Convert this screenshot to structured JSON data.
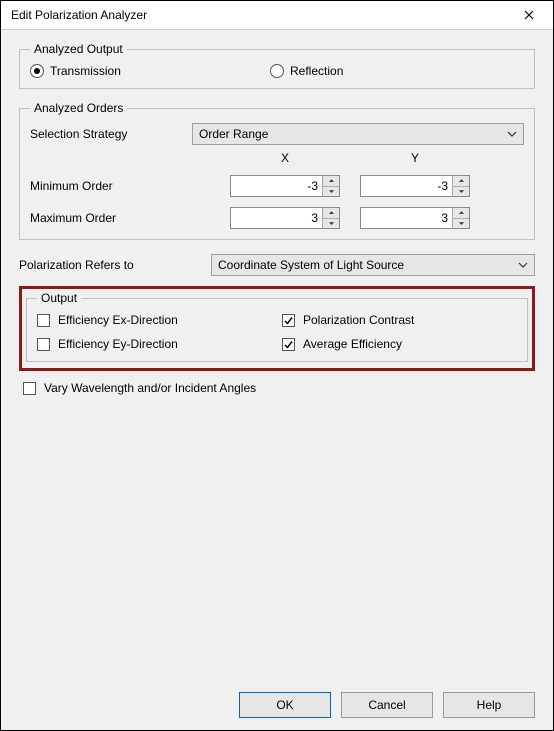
{
  "title": "Edit Polarization Analyzer",
  "analyzed_output": {
    "legend": "Analyzed Output",
    "transmission_label": "Transmission",
    "reflection_label": "Reflection",
    "selected": "transmission"
  },
  "analyzed_orders": {
    "legend": "Analyzed Orders",
    "strategy_label": "Selection Strategy",
    "strategy_value": "Order Range",
    "x_label": "X",
    "y_label": "Y",
    "min_label": "Minimum Order",
    "max_label": "Maximum Order",
    "min_x": "-3",
    "min_y": "-3",
    "max_x": "3",
    "max_y": "3"
  },
  "polarization": {
    "label": "Polarization Refers to",
    "value": "Coordinate System of Light Source"
  },
  "output": {
    "legend": "Output",
    "ex_label": "Efficiency Ex-Direction",
    "ey_label": "Efficiency Ey-Direction",
    "contrast_label": "Polarization Contrast",
    "avg_label": "Average Efficiency",
    "ex_checked": false,
    "ey_checked": false,
    "contrast_checked": true,
    "avg_checked": true
  },
  "vary": {
    "label": "Vary Wavelength and/or Incident Angles",
    "checked": false
  },
  "buttons": {
    "ok": "OK",
    "cancel": "Cancel",
    "help": "Help"
  }
}
